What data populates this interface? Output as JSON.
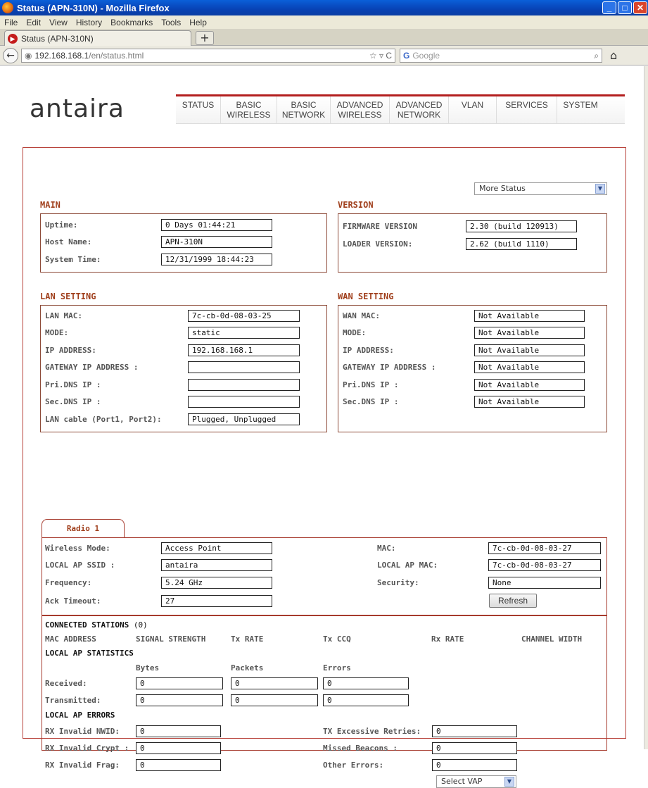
{
  "window": {
    "title": "Status (APN-310N) - Mozilla Firefox"
  },
  "menu": [
    "File",
    "Edit",
    "View",
    "History",
    "Bookmarks",
    "Tools",
    "Help"
  ],
  "tab": {
    "label": "Status (APN-310N)"
  },
  "url": {
    "host": "192.168.168.1",
    "path": "/en/status.html"
  },
  "search": {
    "engine": "Google",
    "placeholder": "Google"
  },
  "logo": "antaira",
  "nav": [
    {
      "l1": "STATUS",
      "l2": ""
    },
    {
      "l1": "BASIC",
      "l2": "WIRELESS"
    },
    {
      "l1": "BASIC",
      "l2": "NETWORK"
    },
    {
      "l1": "ADVANCED",
      "l2": "WIRELESS"
    },
    {
      "l1": "ADVANCED",
      "l2": "NETWORK"
    },
    {
      "l1": "VLAN",
      "l2": ""
    },
    {
      "l1": "SERVICES",
      "l2": ""
    },
    {
      "l1": "SYSTEM",
      "l2": ""
    }
  ],
  "more_status": "More Status",
  "main": {
    "title": "MAIN",
    "uptime_label": "Uptime:",
    "uptime": "0 Days 01:44:21",
    "host_label": "Host Name:",
    "host": "APN-310N",
    "time_label": "System Time:",
    "time": "12/31/1999 18:44:23"
  },
  "version": {
    "title": "VERSION",
    "fw_label": "FIRMWARE VERSION",
    "fw": "2.30 (build 120913)",
    "loader_label": "LOADER VERSION:",
    "loader": "2.62 (build 1110)"
  },
  "lan": {
    "title": "LAN SETTING",
    "rows": [
      {
        "label": "LAN MAC:",
        "value": "7c-cb-0d-08-03-25"
      },
      {
        "label": "MODE:",
        "value": "static"
      },
      {
        "label": "IP ADDRESS:",
        "value": "192.168.168.1"
      },
      {
        "label": "GATEWAY IP ADDRESS :",
        "value": ""
      },
      {
        "label": "Pri.DNS IP :",
        "value": ""
      },
      {
        "label": "Sec.DNS IP :",
        "value": ""
      },
      {
        "label": "LAN cable (Port1, Port2):",
        "value": "Plugged, Unplugged"
      }
    ]
  },
  "wan": {
    "title": "WAN SETTING",
    "rows": [
      {
        "label": "WAN MAC:",
        "value": "Not Available"
      },
      {
        "label": "MODE:",
        "value": "Not Available"
      },
      {
        "label": "IP ADDRESS:",
        "value": "Not Available"
      },
      {
        "label": "GATEWAY IP ADDRESS :",
        "value": "Not Available"
      },
      {
        "label": "Pri.DNS IP :",
        "value": "Not Available"
      },
      {
        "label": "Sec.DNS IP :",
        "value": "Not Available"
      }
    ]
  },
  "radio": {
    "tab": "Radio 1",
    "left": [
      {
        "label": "Wireless Mode:",
        "value": "Access Point"
      },
      {
        "label": "LOCAL AP SSID :",
        "value": "antaira"
      },
      {
        "label": "Frequency:",
        "value": "5.24 GHz"
      },
      {
        "label": "Ack Timeout:",
        "value": "27"
      }
    ],
    "right": [
      {
        "label": "MAC:",
        "value": "7c-cb-0d-08-03-27"
      },
      {
        "label": "LOCAL AP MAC:",
        "value": "7c-cb-0d-08-03-27"
      },
      {
        "label": "Security:",
        "value": "None"
      }
    ],
    "refresh": "Refresh"
  },
  "stations": {
    "title": "CONNECTED STATIONS",
    "count": "(0)",
    "cols": [
      "MAC ADDRESS",
      "SIGNAL STRENGTH",
      "Tx RATE",
      "Tx CCQ",
      "Rx RATE",
      "CHANNEL WIDTH"
    ]
  },
  "stats": {
    "title": "LOCAL AP STATISTICS",
    "cols": [
      "Bytes",
      "Packets",
      "Errors"
    ],
    "received_label": "Received:",
    "received": [
      "0",
      "0",
      "0"
    ],
    "transmitted_label": "Transmitted:",
    "transmitted": [
      "0",
      "0",
      "0"
    ]
  },
  "errors": {
    "title": "LOCAL AP ERRORS",
    "left": [
      {
        "label": "RX Invalid NWID:",
        "value": "0"
      },
      {
        "label": "RX Invalid Crypt :",
        "value": "0"
      },
      {
        "label": "RX Invalid Frag:",
        "value": "0"
      }
    ],
    "right": [
      {
        "label": "TX Excessive Retries:",
        "value": "0"
      },
      {
        "label": "Missed Beacons :",
        "value": "0"
      },
      {
        "label": "Other Errors:",
        "value": "0"
      }
    ]
  },
  "select_vap": "Select VAP"
}
